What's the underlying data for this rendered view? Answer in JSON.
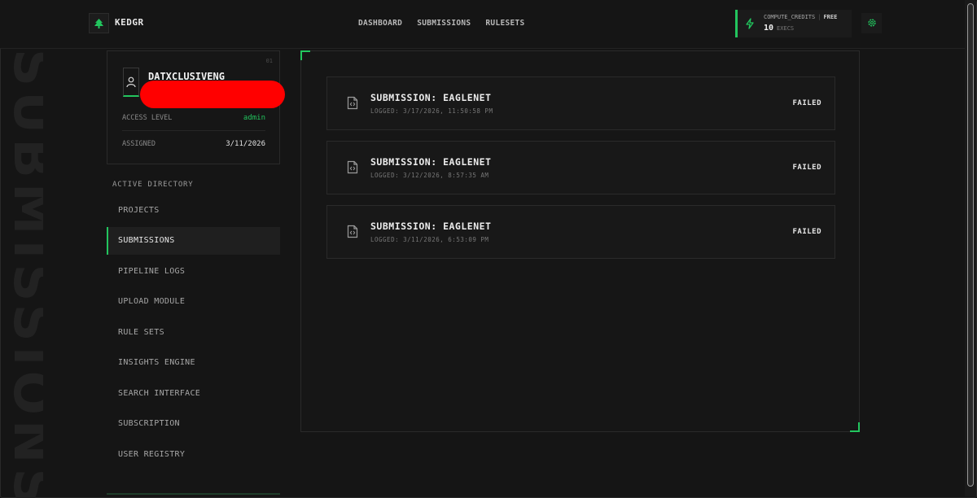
{
  "brand": {
    "name": "KEDGR",
    "accent": "#22c55e"
  },
  "nav": {
    "items": [
      "DASHBOARD",
      "SUBMISSIONS",
      "RULESETS"
    ]
  },
  "credits": {
    "label": "COMPUTE_CREDITS",
    "plan": "FREE",
    "value": "10",
    "unit": "EXECS"
  },
  "background_text": "SUBMISSIONS",
  "profile": {
    "index": "01",
    "username": "DATXCLUSIVENG",
    "access_label": "ACCESS LEVEL",
    "access_value": "admin",
    "assigned_label": "ASSIGNED",
    "assigned_value": "3/11/2026"
  },
  "sidebar": {
    "directory_label": "ACTIVE DIRECTORY",
    "items": [
      {
        "label": "PROJECTS",
        "active": false
      },
      {
        "label": "SUBMISSIONS",
        "active": true
      },
      {
        "label": "PIPELINE LOGS",
        "active": false
      },
      {
        "label": "UPLOAD MODULE",
        "active": false
      },
      {
        "label": "RULE SETS",
        "active": false
      },
      {
        "label": "INSIGHTS ENGINE",
        "active": false
      },
      {
        "label": "SEARCH INTERFACE",
        "active": false
      },
      {
        "label": "SUBSCRIPTION",
        "active": false
      },
      {
        "label": "USER REGISTRY",
        "active": false
      }
    ]
  },
  "submissions": [
    {
      "title": "SUBMISSION: EAGLENET",
      "logged": "LOGGED: 3/17/2026, 11:50:58 PM",
      "status": "FAILED"
    },
    {
      "title": "SUBMISSION: EAGLENET",
      "logged": "LOGGED: 3/12/2026, 8:57:35 AM",
      "status": "FAILED"
    },
    {
      "title": "SUBMISSION: EAGLENET",
      "logged": "LOGGED: 3/11/2026, 6:53:09 PM",
      "status": "FAILED"
    }
  ],
  "icons": {
    "logo": "tree-logo-icon",
    "credits": "lightning-bolt-icon",
    "settings": "gear-icon",
    "user": "user-icon",
    "file": "code-file-icon"
  }
}
